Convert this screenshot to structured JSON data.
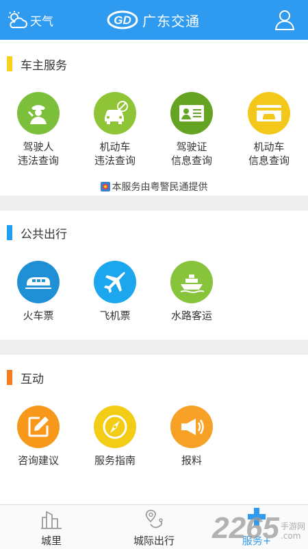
{
  "header": {
    "weather_label": "天气",
    "app_title": "广东交通",
    "logo_text": "GD",
    "brand_color": "#2f9bf0",
    "user_icon": "user-icon"
  },
  "sections": {
    "owner": {
      "title": "车主服务",
      "bar_color": "#f6d21b",
      "items": [
        {
          "label_line1": "驾驶人",
          "label_line2": "违法查询",
          "icon": "police-icon",
          "color": "#7bbf3a"
        },
        {
          "label_line1": "机动车",
          "label_line2": "违法查询",
          "icon": "car-violation-icon",
          "color": "#8fc436"
        },
        {
          "label_line1": "驾驶证",
          "label_line2": "信息查询",
          "icon": "license-card-icon",
          "color": "#65a323"
        },
        {
          "label_line1": "机动车",
          "label_line2": "信息查询",
          "icon": "vehicle-card-icon",
          "color": "#f3c81a"
        }
      ],
      "provider_text": "本服务由粤警民通提供"
    },
    "public": {
      "title": "公共出行",
      "bar_color": "#1e9ff2",
      "items": [
        {
          "label": "火车票",
          "icon": "train-icon",
          "color": "#1f8fd6"
        },
        {
          "label": "飞机票",
          "icon": "airplane-icon",
          "color": "#1ba6ee"
        },
        {
          "label": "水路客运",
          "icon": "ship-icon",
          "color": "#88c33c"
        }
      ]
    },
    "interact": {
      "title": "互动",
      "bar_color": "#f57c1f",
      "items": [
        {
          "label": "咨询建议",
          "icon": "edit-icon",
          "color": "#f7981b"
        },
        {
          "label": "服务指南",
          "icon": "compass-icon",
          "color": "#f3cc15"
        },
        {
          "label": "报料",
          "icon": "megaphone-icon",
          "color": "#f7a226"
        }
      ]
    }
  },
  "bottom_nav": {
    "items": [
      {
        "label": "城里",
        "icon": "city-icon",
        "active": false
      },
      {
        "label": "城际出行",
        "icon": "map-pin-route-icon",
        "active": false
      },
      {
        "label": "服务+",
        "icon": "plus-icon",
        "active": true
      }
    ]
  },
  "watermark": {
    "big": "2265",
    "small_line1": "手游网",
    "small_line2": ".com"
  }
}
